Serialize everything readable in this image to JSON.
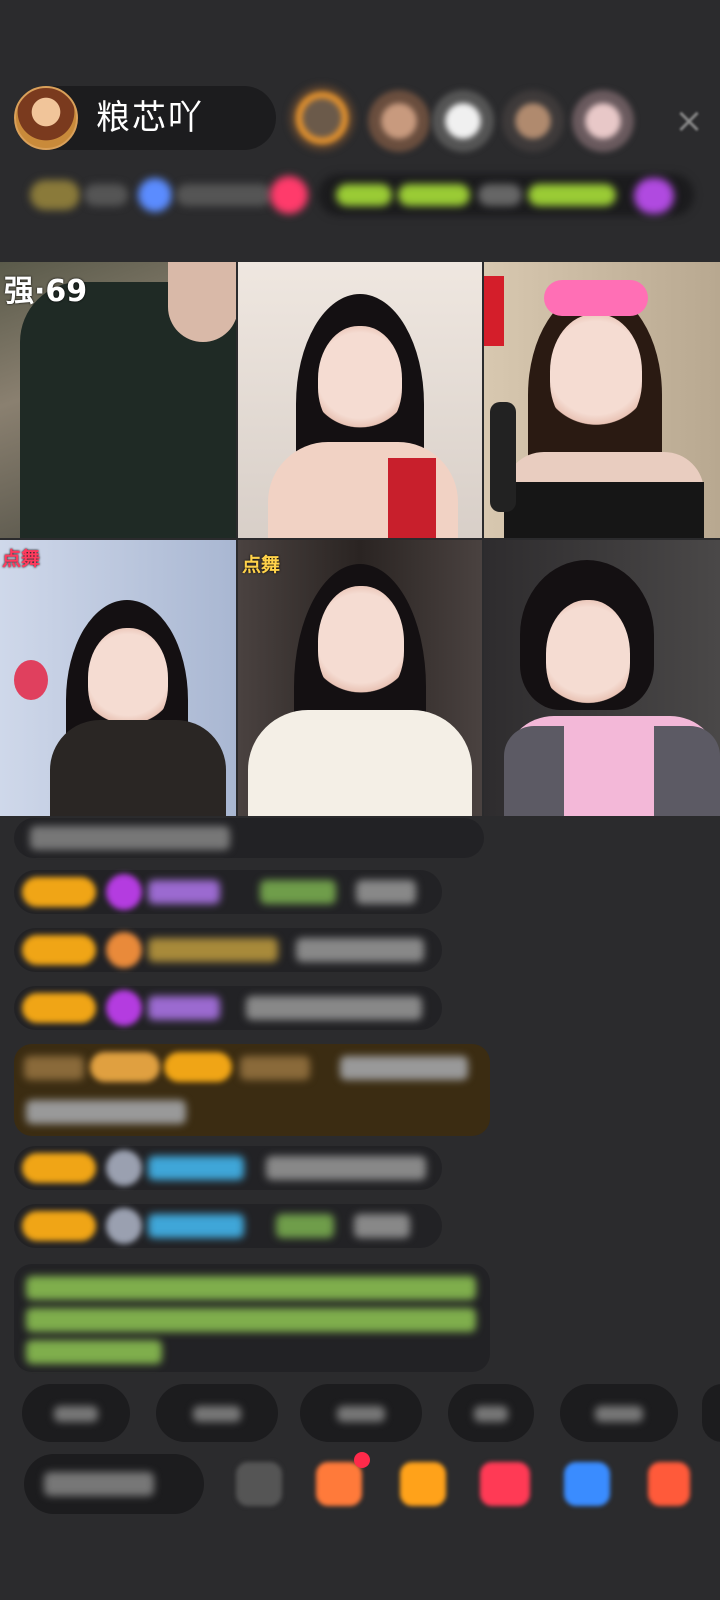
{
  "header": {
    "host_name": "粮芯吖"
  },
  "grid": {
    "tiles": [
      {
        "caption": "强·69"
      },
      {
        "caption": ""
      },
      {
        "caption": ""
      },
      {
        "caption": "点舞"
      },
      {
        "caption": "点舞"
      },
      {
        "caption": ""
      }
    ]
  },
  "colors": {
    "background": "#2b2b2d",
    "badge_gold": "#f0a516",
    "gift_purple": "#b43ce0",
    "chat_green": "#8bd35c",
    "chat_cyan": "#3fa6d8"
  }
}
